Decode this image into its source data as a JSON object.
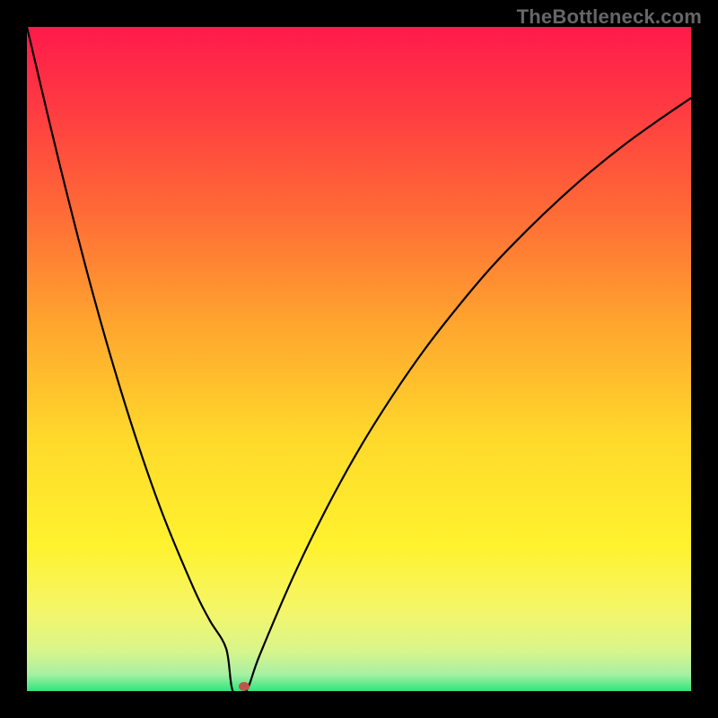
{
  "watermark": "TheBottleneck.com",
  "chart_data": {
    "type": "line",
    "title": "",
    "xlabel": "",
    "ylabel": "",
    "xlim": [
      0,
      1
    ],
    "ylim": [
      0,
      100
    ],
    "series": [
      {
        "name": "curve",
        "x": [
          0.0,
          0.05,
          0.1,
          0.15,
          0.2,
          0.25,
          0.275,
          0.3,
          0.31,
          0.33,
          0.35,
          0.4,
          0.45,
          0.5,
          0.55,
          0.6,
          0.65,
          0.7,
          0.75,
          0.8,
          0.85,
          0.9,
          0.95,
          1.0
        ],
        "y": [
          100.0,
          79.0,
          59.6,
          42.5,
          27.8,
          15.7,
          10.7,
          6.4,
          0.0,
          0.0,
          5.3,
          17.0,
          27.3,
          36.4,
          44.4,
          51.6,
          58.0,
          63.9,
          69.1,
          73.9,
          78.3,
          82.3,
          85.9,
          89.3
        ]
      }
    ],
    "gradient_stops": [
      {
        "offset": 0.0,
        "color": "#ff1a4b"
      },
      {
        "offset": 0.12,
        "color": "#ff3a42"
      },
      {
        "offset": 0.28,
        "color": "#ff6b36"
      },
      {
        "offset": 0.45,
        "color": "#ffa62e"
      },
      {
        "offset": 0.62,
        "color": "#ffd92b"
      },
      {
        "offset": 0.78,
        "color": "#fff22e"
      },
      {
        "offset": 0.88,
        "color": "#f4f66a"
      },
      {
        "offset": 0.94,
        "color": "#d8f58c"
      },
      {
        "offset": 0.975,
        "color": "#a6f0a3"
      },
      {
        "offset": 1.0,
        "color": "#2ee67a"
      }
    ],
    "marker": {
      "x": 0.327,
      "y": 0.7,
      "color": "#c0544a",
      "rx": 6,
      "ry": 5
    }
  }
}
